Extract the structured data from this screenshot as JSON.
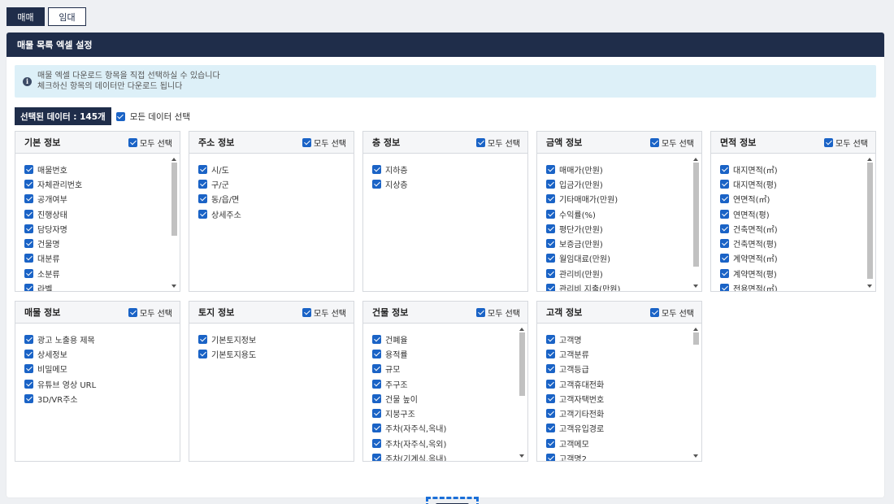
{
  "tabs": [
    {
      "label": "매매",
      "active": true
    },
    {
      "label": "임대",
      "active": false
    }
  ],
  "panel_title": "매물 목록 엑셀 설정",
  "info": {
    "icon": "info-icon",
    "line1": "매물 엑셀 다운로드 항목을 직접 선택하실 수 있습니다",
    "line2": "체크하신 항목의 데이터만 다운로드 됩니다"
  },
  "selection": {
    "count_label": "선택된 데이터 : 145개",
    "select_all_data_label": "모든 데이터 선택",
    "checked": true
  },
  "select_all_label": "모두 선택",
  "colors": {
    "navy": "#1f2d4a",
    "checkbox": "#1a63c6",
    "info_bg": "#ddf0f8",
    "highlight": "#1a6fd8"
  },
  "cards": [
    {
      "title": "기본 정보",
      "items": [
        "매물번호",
        "자체관리번호",
        "공개여부",
        "진행상태",
        "담당자명",
        "건물명",
        "대분류",
        "소분류",
        "라벨"
      ],
      "scroll": true,
      "thumb_top": 0.0,
      "thumb_size": 0.6
    },
    {
      "title": "주소 정보",
      "items": [
        "시/도",
        "구/군",
        "동/읍/면",
        "상세주소"
      ],
      "scroll": false
    },
    {
      "title": "층 정보",
      "items": [
        "지하층",
        "지상층"
      ],
      "scroll": false
    },
    {
      "title": "금액 정보",
      "items": [
        "매매가(만원)",
        "입금가(만원)",
        "기타매매가(만원)",
        "수익률(%)",
        "평단가(만원)",
        "보증금(만원)",
        "월임대료(만원)",
        "관리비(만원)",
        "관리비 지출(만원)"
      ],
      "scroll": true,
      "thumb_top": 0.0,
      "thumb_size": 0.85
    },
    {
      "title": "면적 정보",
      "items": [
        "대지면적(㎡)",
        "대지면적(평)",
        "연면적(㎡)",
        "연면적(평)",
        "건축면적(㎡)",
        "건축면적(평)",
        "계약면적(㎡)",
        "계약면적(평)",
        "전용면적(㎡)"
      ],
      "scroll": true,
      "thumb_top": 0.0,
      "thumb_size": 0.95
    },
    {
      "title": "매물 정보",
      "items": [
        "광고 노출용 제목",
        "상세정보",
        "비밀메모",
        "유튜브 영상 URL",
        "3D/VR주소"
      ],
      "scroll": false
    },
    {
      "title": "토지 정보",
      "items": [
        "기본토지정보",
        "기본토지용도"
      ],
      "scroll": false
    },
    {
      "title": "건물 정보",
      "items": [
        "건폐율",
        "용적률",
        "규모",
        "주구조",
        "건물 높이",
        "지붕구조",
        "주차(자주식,옥내)",
        "주차(자주식,옥외)",
        "주차(기계식,옥내)"
      ],
      "scroll": true,
      "thumb_top": 0.0,
      "thumb_size": 0.52
    },
    {
      "title": "고객 정보",
      "items": [
        "고객명",
        "고객분류",
        "고객등급",
        "고객휴대전화",
        "고객자택번호",
        "고객기타전화",
        "고객유입경로",
        "고객메모",
        "고객명2"
      ],
      "scroll": true,
      "thumb_top": 0.0,
      "thumb_size": 0.1
    }
  ],
  "save_label": "저장"
}
